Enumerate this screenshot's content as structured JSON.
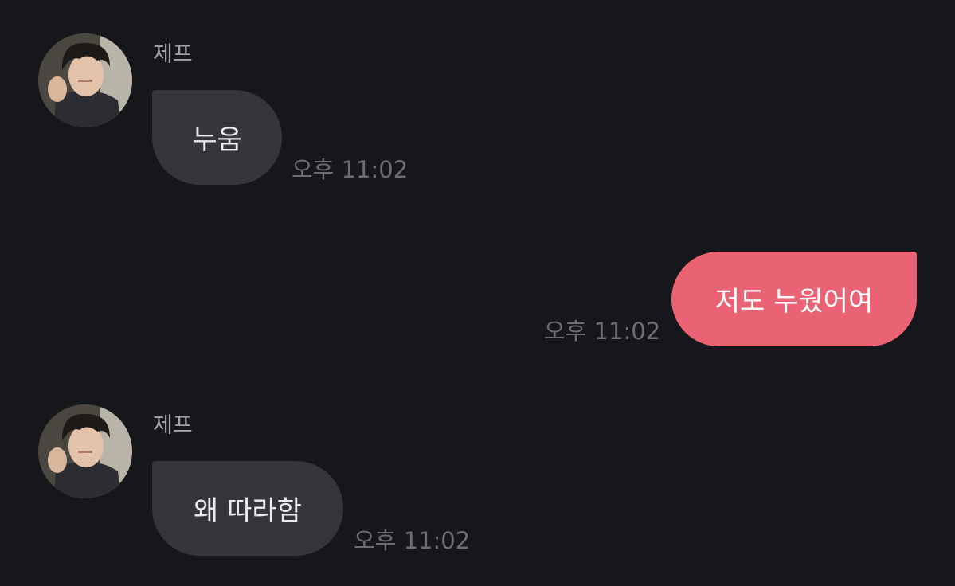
{
  "messages": [
    {
      "sender": "제프",
      "text": "누움",
      "time": "오후 11:02"
    },
    {
      "text": "저도 누웠어여",
      "time": "오후 11:02"
    },
    {
      "sender": "제프",
      "text": "왜 따라함",
      "time": "오후 11:02"
    }
  ],
  "colors": {
    "background": "#16171b",
    "incoming_bubble": "#35363b",
    "outgoing_bubble": "#e96374",
    "timestamp": "#6d6e73",
    "sender_name": "#a3a4a8"
  }
}
